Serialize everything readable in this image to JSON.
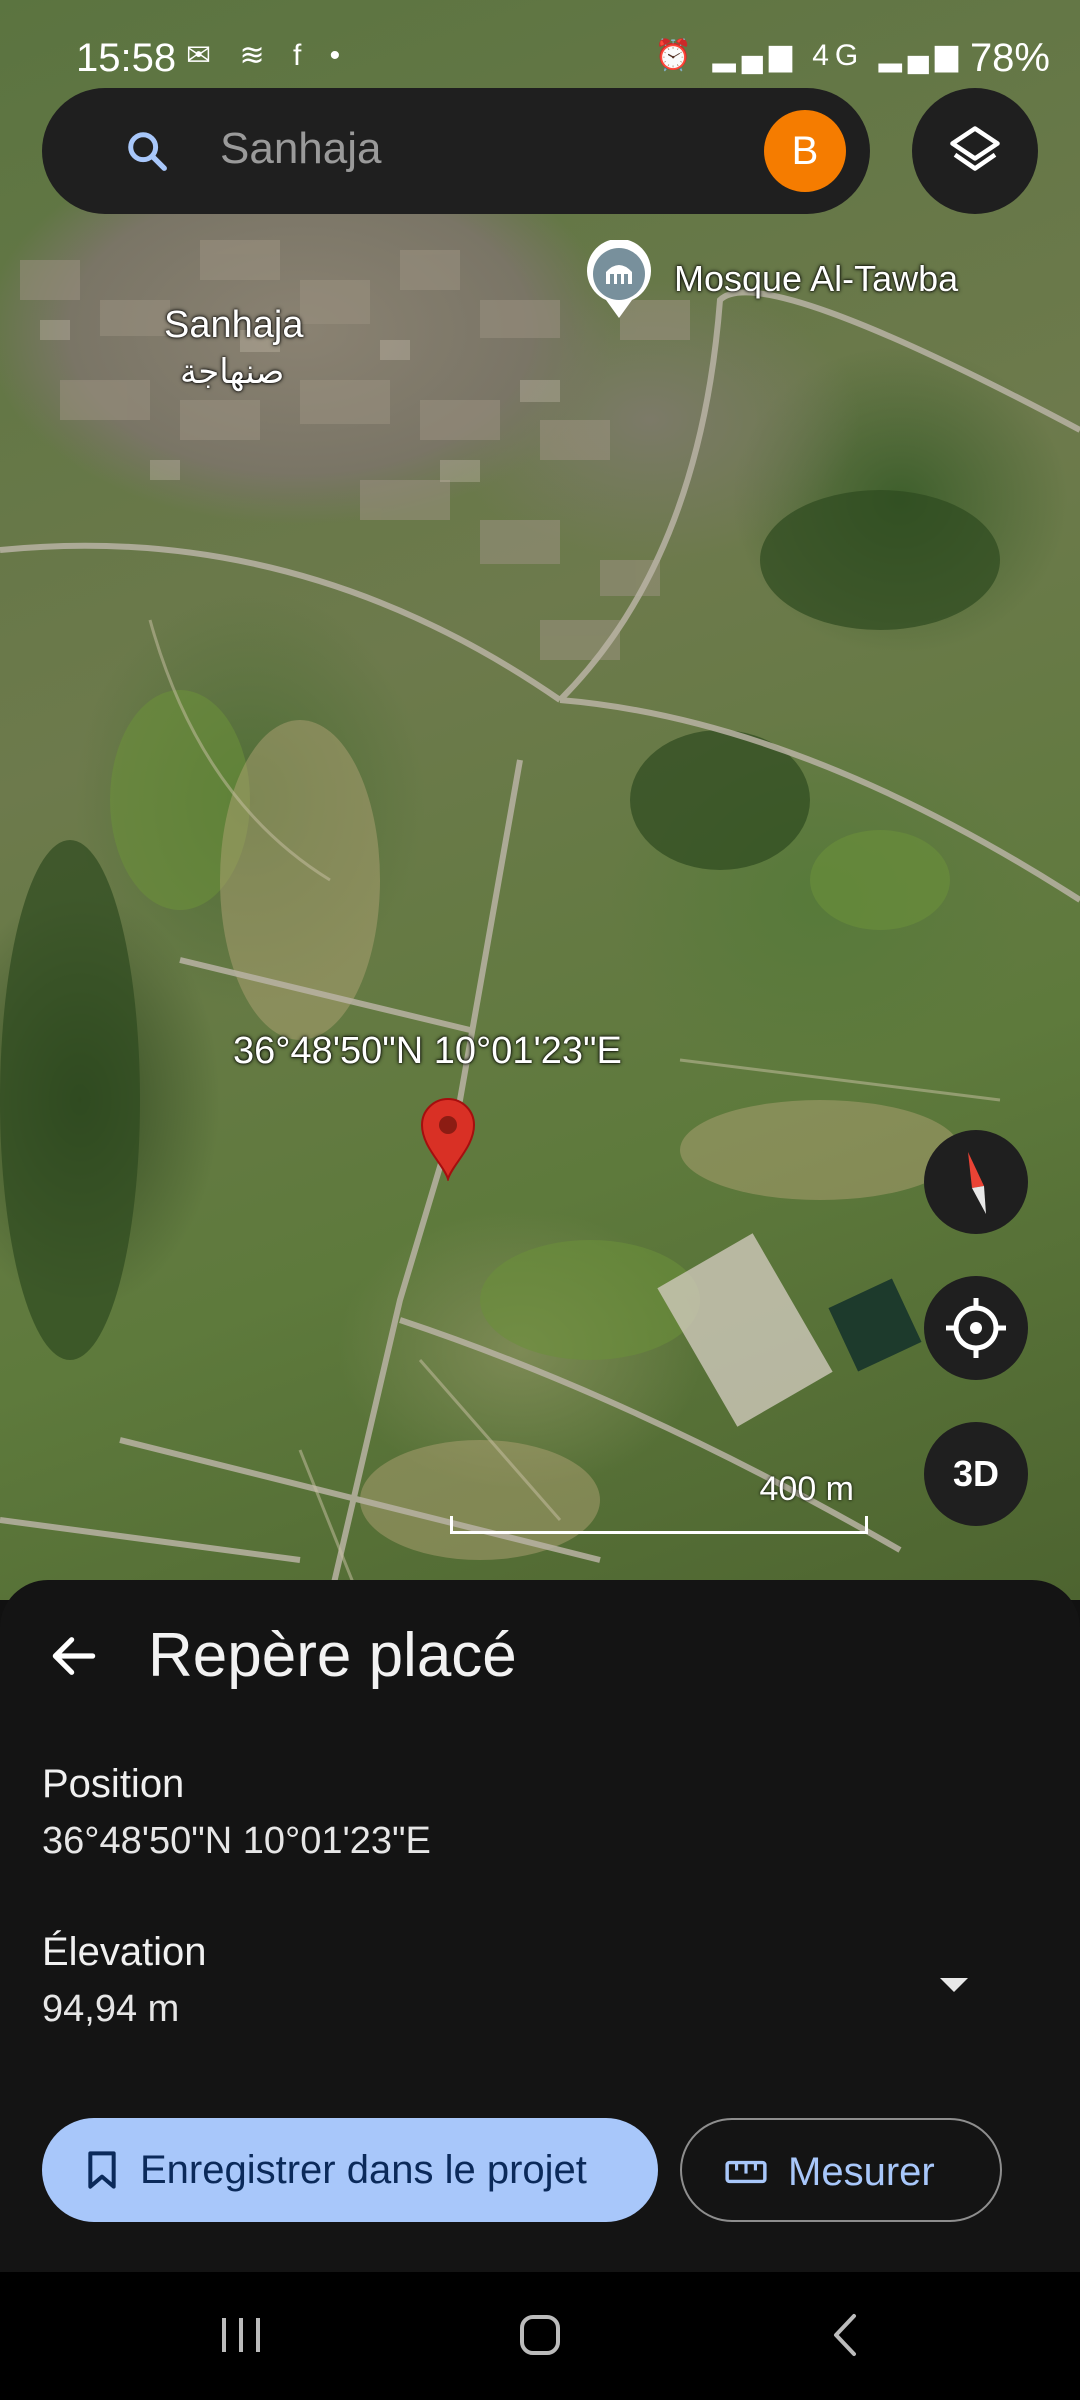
{
  "status_bar": {
    "time": "15:58",
    "left_icons": "✉ ≋ f •",
    "right_icons": "⏰ ▂▄▆ 4G ▂▄▆",
    "battery": "78%"
  },
  "search": {
    "query": "Sanhaja",
    "avatar_letter": "B"
  },
  "map": {
    "place_label": "Sanhaja",
    "place_label_ar": "صنهاجة",
    "poi_label": "Mosque Al-Tawba",
    "pin_coordinates": "36°48'50\"N 10°01'23\"E",
    "scale_label": "400 m",
    "button_3d": "3D"
  },
  "sheet": {
    "title": "Repère placé",
    "position_label": "Position",
    "position_value": "36°48'50\"N 10°01'23\"E",
    "elevation_label": "Élevation",
    "elevation_value": "94,94 m",
    "save_button": "Enregistrer dans le projet",
    "measure_button": "Mesurer"
  },
  "colors": {
    "accent": "#a8c7fa",
    "avatar": "#f57c00",
    "pin": "#d93025"
  },
  "icons": {
    "search": "search-icon",
    "layers": "layers-icon",
    "compass": "compass-icon",
    "locate": "my-location-icon",
    "back": "arrow-back-icon",
    "dropdown": "dropdown-arrow-icon",
    "save": "bookmark-icon",
    "measure": "ruler-icon"
  }
}
